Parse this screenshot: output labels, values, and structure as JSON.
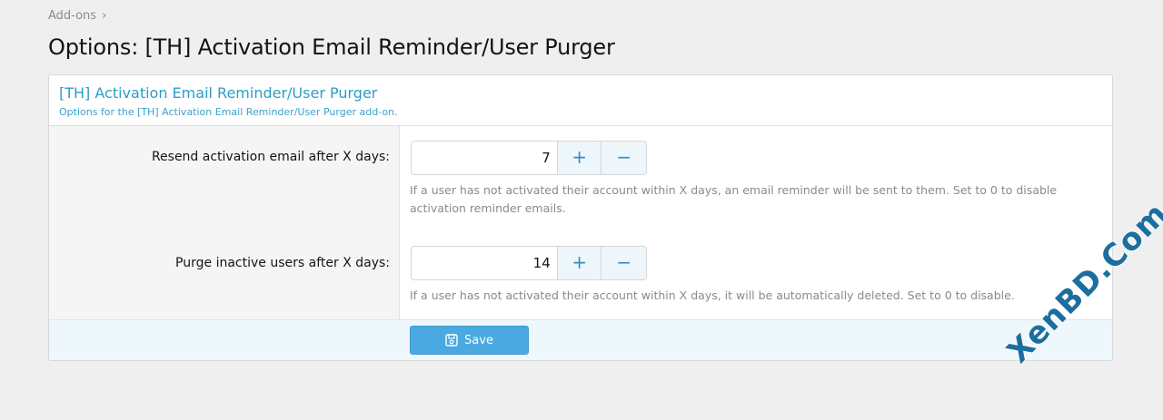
{
  "breadcrumb": {
    "item": "Add-ons",
    "separator": "›"
  },
  "page": {
    "title": "Options: [TH] Activation Email Reminder/User Purger"
  },
  "block": {
    "title": "[TH] Activation Email Reminder/User Purger",
    "description": "Options for the [TH] Activation Email Reminder/User Purger add-on."
  },
  "options": [
    {
      "label": "Resend activation email after X days:",
      "value": "7",
      "hint": "If a user has not activated their account within X days, an email reminder will be sent to them. Set to 0 to disable activation reminder emails."
    },
    {
      "label": "Purge inactive users after X days:",
      "value": "14",
      "hint": "If a user has not activated their account within X days, it will be automatically deleted. Set to 0 to disable."
    }
  ],
  "stepper": {
    "plus": "+",
    "minus": "−"
  },
  "footer": {
    "save_label": "Save"
  },
  "watermark": "XenBD.Com",
  "colors": {
    "accent": "#49a9e0",
    "title": "#2b9dc6",
    "hint": "#8a8a8a"
  },
  "icons": {
    "save": "floppy-disk-icon"
  }
}
